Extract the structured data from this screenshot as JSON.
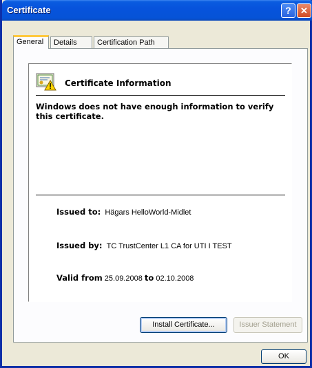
{
  "window": {
    "title": "Certificate"
  },
  "controls": {
    "help": "?",
    "close": "✕"
  },
  "tabs": [
    {
      "label": "General",
      "active": true
    },
    {
      "label": "Details",
      "active": false
    },
    {
      "label": "Certification Path",
      "active": false
    }
  ],
  "info": {
    "heading": "Certificate Information",
    "warning": "Windows does not have enough information to verify this certificate.",
    "issued_to_label": "Issued to:",
    "issued_to": "Hägars HelloWorld-Midlet",
    "issued_by_label": "Issued by:",
    "issued_by": "TC TrustCenter L1 CA for UTI I TEST",
    "valid_from_label": "Valid from",
    "valid_from": "25.09.2008",
    "to_label": "to",
    "valid_to": "02.10.2008"
  },
  "buttons": {
    "install": "Install Certificate...",
    "issuer": "Issuer Statement",
    "ok": "OK"
  },
  "icons": {
    "certificate": "certificate-warning-icon"
  },
  "colors": {
    "titlebar": "#0753dc",
    "tab_highlight": "#ffc83c",
    "window_bg": "#ece9d8"
  }
}
